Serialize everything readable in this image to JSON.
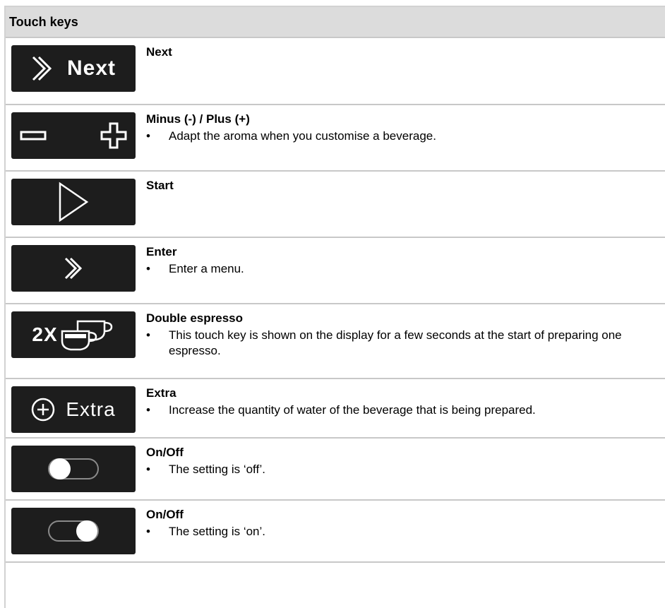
{
  "header": {
    "title": "Touch keys"
  },
  "rows": [
    {
      "key_label": "Next",
      "title": "Next",
      "bullets": []
    },
    {
      "key_label": "",
      "title": "Minus (-) / Plus (+)",
      "bullets": [
        "Adapt the aroma when you customise a beverage."
      ]
    },
    {
      "key_label": "",
      "title": "Start",
      "bullets": []
    },
    {
      "key_label": "",
      "title": "Enter",
      "bullets": [
        "Enter a menu."
      ]
    },
    {
      "key_label": "2X",
      "title": "Double espresso",
      "bullets": [
        "This touch key is shown on the display for a few seconds at the start of preparing one espresso."
      ]
    },
    {
      "key_label": "Extra",
      "title": "Extra",
      "bullets": [
        "Increase the quantity of water of the beverage that is being prepared."
      ]
    },
    {
      "key_label": "",
      "title": "On/Off",
      "bullets": [
        "The setting is ‘off’."
      ]
    },
    {
      "key_label": "",
      "title": "On/Off",
      "bullets": [
        "The setting is ‘on’."
      ]
    }
  ],
  "bullet_symbol": "•",
  "icons": {
    "row0": "double-chevron-right-icon",
    "row1": "minus-plus-icon",
    "row2": "play-icon",
    "row3": "double-chevron-right-icon",
    "row4": "double-espresso-cups-icon",
    "row5": "plus-circle-icon",
    "row6": "toggle-off-icon",
    "row7": "toggle-on-icon"
  }
}
